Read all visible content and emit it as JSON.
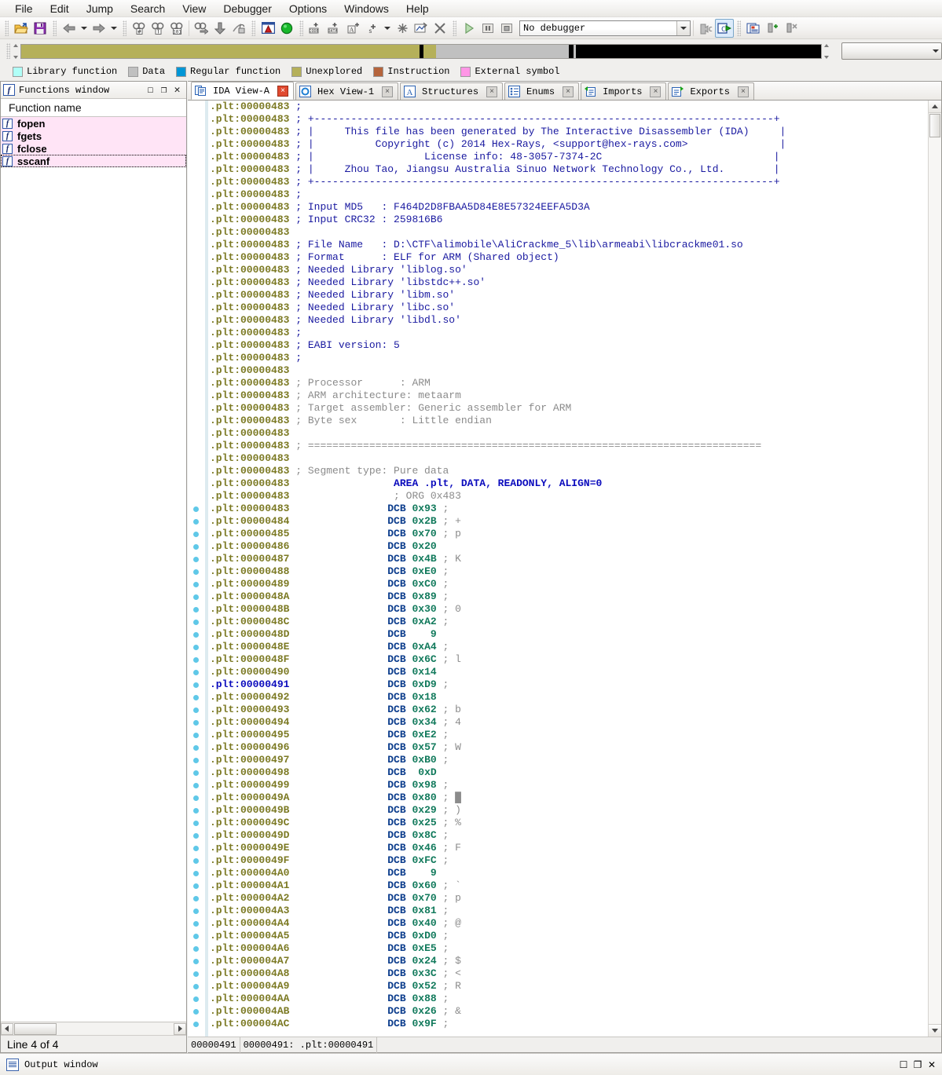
{
  "menu": {
    "items": [
      "File",
      "Edit",
      "Jump",
      "Search",
      "View",
      "Debugger",
      "Options",
      "Windows",
      "Help"
    ]
  },
  "toolbar": {
    "debugger_value": "No debugger",
    "icons": [
      "open-file-icon",
      "save-icon",
      "back-arrow-icon",
      "back-dropdown-icon",
      "forward-arrow-icon",
      "forward-dropdown-icon",
      "search-hash-icon",
      "search-text-icon",
      "search-binary-icon",
      "search-next-icon",
      "jump-down-icon",
      "unlock-icon",
      "warning-icon",
      "green-circle-icon",
      "make-code-icon",
      "make-data-icon",
      "make-ascii-icon",
      "make-struct-icon",
      "make-struct-dropdown-icon",
      "make-unexplored-icon",
      "edit-function-icon",
      "delete-icon",
      "run-icon",
      "pause-icon",
      "stop-icon"
    ],
    "right_icons": [
      "decompile-gray-icon",
      "decompile-icon",
      "struct-view-icon",
      "add-breakpoint-icon",
      "delete-breakpoint-icon"
    ]
  },
  "navbar": {
    "combo_value": "",
    "segments": [
      {
        "name": "unexplored-left",
        "color": "#b5b05a",
        "left_pct": 0.0,
        "width_pct": 49.8
      },
      {
        "name": "cursor-marker",
        "color": "#000000",
        "left_pct": 49.8,
        "width_pct": 0.5
      },
      {
        "name": "unexplored-right",
        "color": "#b5b05a",
        "left_pct": 50.3,
        "width_pct": 1.6
      },
      {
        "name": "data-gray",
        "color": "#c0c0c0",
        "left_pct": 51.9,
        "width_pct": 16.6
      },
      {
        "name": "divider-marker",
        "color": "#000000",
        "left_pct": 68.5,
        "width_pct": 0.6
      },
      {
        "name": "black-region",
        "color": "#000000",
        "left_pct": 69.4,
        "width_pct": 30.6
      }
    ]
  },
  "legend": {
    "items": [
      {
        "label": "Library function",
        "color": "#b0fff7"
      },
      {
        "label": "Data",
        "color": "#c0c0c0"
      },
      {
        "label": "Regular function",
        "color": "#0096d6"
      },
      {
        "label": "Unexplored",
        "color": "#b5b05a"
      },
      {
        "label": "Instruction",
        "color": "#b5643c"
      },
      {
        "label": "External symbol",
        "color": "#ff96e6"
      }
    ]
  },
  "functions_window": {
    "title": "Functions window",
    "column_header": "Function name",
    "rows": [
      "fopen",
      "fgets",
      "fclose",
      "sscanf"
    ],
    "selected_index": 3,
    "status": "Line 4 of 4",
    "window_buttons": [
      "maximize",
      "restore",
      "close"
    ]
  },
  "tabs": [
    {
      "label": "IDA View-A",
      "icon": "ida-view-icon",
      "active": true,
      "close_red": true
    },
    {
      "label": "Hex View-1",
      "icon": "hex-view-icon",
      "active": false,
      "close_red": false
    },
    {
      "label": "Structures",
      "icon": "structures-icon",
      "active": false,
      "close_red": false
    },
    {
      "label": "Enums",
      "icon": "enums-icon",
      "active": false,
      "close_red": false
    },
    {
      "label": "Imports",
      "icon": "imports-icon",
      "active": false,
      "close_red": false
    },
    {
      "label": "Exports",
      "icon": "exports-icon",
      "active": false,
      "close_red": false
    }
  ],
  "disassembly": {
    "current_address": "00000491",
    "lines": [
      {
        "addr": ".plt:00000483",
        "text": "; ",
        "style": "cmt"
      },
      {
        "addr": ".plt:00000483",
        "text": "; +---------------------------------------------------------------------------+",
        "style": "cmt"
      },
      {
        "addr": ".plt:00000483",
        "text": "; |     This file has been generated by The Interactive Disassembler (IDA)     |",
        "style": "cmt"
      },
      {
        "addr": ".plt:00000483",
        "text": "; |          Copyright (c) 2014 Hex-Rays, <support@hex-rays.com>               |",
        "style": "cmt"
      },
      {
        "addr": ".plt:00000483",
        "text": "; |                  License info: 48-3057-7374-2C                            |",
        "style": "cmt"
      },
      {
        "addr": ".plt:00000483",
        "text": "; |     Zhou Tao, Jiangsu Australia Sinuo Network Technology Co., Ltd.        |",
        "style": "cmt"
      },
      {
        "addr": ".plt:00000483",
        "text": "; +---------------------------------------------------------------------------+",
        "style": "cmt"
      },
      {
        "addr": ".plt:00000483",
        "text": "; ",
        "style": "cmt"
      },
      {
        "addr": ".plt:00000483",
        "text": "; Input MD5   : F464D2D8FBAA5D84E8E57324EEFA5D3A",
        "style": "cmt"
      },
      {
        "addr": ".plt:00000483",
        "text": "; Input CRC32 : 259816B6",
        "style": "cmt"
      },
      {
        "addr": ".plt:00000483",
        "text": "",
        "style": "cmt"
      },
      {
        "addr": ".plt:00000483",
        "text": "; File Name   : D:\\CTF\\alimobile\\AliCrackme_5\\lib\\armeabi\\libcrackme01.so",
        "style": "cmt"
      },
      {
        "addr": ".plt:00000483",
        "text": "; Format      : ELF for ARM (Shared object)",
        "style": "cmt"
      },
      {
        "addr": ".plt:00000483",
        "text": "; Needed Library 'liblog.so'",
        "style": "cmt"
      },
      {
        "addr": ".plt:00000483",
        "text": "; Needed Library 'libstdc++.so'",
        "style": "cmt"
      },
      {
        "addr": ".plt:00000483",
        "text": "; Needed Library 'libm.so'",
        "style": "cmt"
      },
      {
        "addr": ".plt:00000483",
        "text": "; Needed Library 'libc.so'",
        "style": "cmt"
      },
      {
        "addr": ".plt:00000483",
        "text": "; Needed Library 'libdl.so'",
        "style": "cmt"
      },
      {
        "addr": ".plt:00000483",
        "text": "; ",
        "style": "cmt"
      },
      {
        "addr": ".plt:00000483",
        "text": "; EABI version: 5",
        "style": "cmt"
      },
      {
        "addr": ".plt:00000483",
        "text": "; ",
        "style": "cmt"
      },
      {
        "addr": ".plt:00000483",
        "text": "",
        "style": "cmt"
      },
      {
        "addr": ".plt:00000483",
        "text": "; Processor      : ARM",
        "style": "cmtgray"
      },
      {
        "addr": ".plt:00000483",
        "text": "; ARM architecture: metaarm",
        "style": "cmtgray"
      },
      {
        "addr": ".plt:00000483",
        "text": "; Target assembler: Generic assembler for ARM",
        "style": "cmtgray"
      },
      {
        "addr": ".plt:00000483",
        "text": "; Byte sex       : Little endian",
        "style": "cmtgray"
      },
      {
        "addr": ".plt:00000483",
        "text": "",
        "style": "cmtgray"
      },
      {
        "addr": ".plt:00000483",
        "text": "; ==========================================================================",
        "style": "cmtgray"
      },
      {
        "addr": ".plt:00000483",
        "text": "",
        "style": "cmtgray"
      },
      {
        "addr": ".plt:00000483",
        "text": "; Segment type: Pure data",
        "style": "cmtgray"
      },
      {
        "addr": ".plt:00000483",
        "text": "                AREA .plt, DATA, READONLY, ALIGN=0",
        "style": "kw"
      },
      {
        "addr": ".plt:00000483",
        "text": "                ; ORG 0x483",
        "style": "cmtgray"
      }
    ],
    "dcb_lines": [
      {
        "addr": ".plt:00000483",
        "mnem": "DCB",
        "value": "0x93",
        "comment": ";",
        "ascii": ""
      },
      {
        "addr": ".plt:00000484",
        "mnem": "DCB",
        "value": "0x2B",
        "comment": ";",
        "ascii": "+"
      },
      {
        "addr": ".plt:00000485",
        "mnem": "DCB",
        "value": "0x70",
        "comment": ";",
        "ascii": "p"
      },
      {
        "addr": ".plt:00000486",
        "mnem": "DCB",
        "value": "0x20",
        "comment": "",
        "ascii": ""
      },
      {
        "addr": ".plt:00000487",
        "mnem": "DCB",
        "value": "0x4B",
        "comment": ";",
        "ascii": "K"
      },
      {
        "addr": ".plt:00000488",
        "mnem": "DCB",
        "value": "0xE0",
        "comment": ";",
        "ascii": ""
      },
      {
        "addr": ".plt:00000489",
        "mnem": "DCB",
        "value": "0xC0",
        "comment": ";",
        "ascii": ""
      },
      {
        "addr": ".plt:0000048A",
        "mnem": "DCB",
        "value": "0x89",
        "comment": ";",
        "ascii": ""
      },
      {
        "addr": ".plt:0000048B",
        "mnem": "DCB",
        "value": "0x30",
        "comment": ";",
        "ascii": "0"
      },
      {
        "addr": ".plt:0000048C",
        "mnem": "DCB",
        "value": "0xA2",
        "comment": ";",
        "ascii": ""
      },
      {
        "addr": ".plt:0000048D",
        "mnem": "DCB",
        "value": "   9",
        "comment": "",
        "ascii": ""
      },
      {
        "addr": ".plt:0000048E",
        "mnem": "DCB",
        "value": "0xA4",
        "comment": ";",
        "ascii": ""
      },
      {
        "addr": ".plt:0000048F",
        "mnem": "DCB",
        "value": "0x6C",
        "comment": ";",
        "ascii": "l"
      },
      {
        "addr": ".plt:00000490",
        "mnem": "DCB",
        "value": "0x14",
        "comment": "",
        "ascii": ""
      },
      {
        "addr": ".plt:00000491",
        "mnem": "DCB",
        "value": "0xD9",
        "comment": ";",
        "ascii": "",
        "current": true
      },
      {
        "addr": ".plt:00000492",
        "mnem": "DCB",
        "value": "0x18",
        "comment": "",
        "ascii": ""
      },
      {
        "addr": ".plt:00000493",
        "mnem": "DCB",
        "value": "0x62",
        "comment": ";",
        "ascii": "b"
      },
      {
        "addr": ".plt:00000494",
        "mnem": "DCB",
        "value": "0x34",
        "comment": ";",
        "ascii": "4"
      },
      {
        "addr": ".plt:00000495",
        "mnem": "DCB",
        "value": "0xE2",
        "comment": ";",
        "ascii": ""
      },
      {
        "addr": ".plt:00000496",
        "mnem": "DCB",
        "value": "0x57",
        "comment": ";",
        "ascii": "W"
      },
      {
        "addr": ".plt:00000497",
        "mnem": "DCB",
        "value": "0xB0",
        "comment": ";",
        "ascii": ""
      },
      {
        "addr": ".plt:00000498",
        "mnem": "DCB",
        "value": " 0xD",
        "comment": "",
        "ascii": ""
      },
      {
        "addr": ".plt:00000499",
        "mnem": "DCB",
        "value": "0x98",
        "comment": ";",
        "ascii": ""
      },
      {
        "addr": ".plt:0000049A",
        "mnem": "DCB",
        "value": "0x80",
        "comment": ";",
        "ascii": "█"
      },
      {
        "addr": ".plt:0000049B",
        "mnem": "DCB",
        "value": "0x29",
        "comment": ";",
        "ascii": ")"
      },
      {
        "addr": ".plt:0000049C",
        "mnem": "DCB",
        "value": "0x25",
        "comment": ";",
        "ascii": "%"
      },
      {
        "addr": ".plt:0000049D",
        "mnem": "DCB",
        "value": "0x8C",
        "comment": ";",
        "ascii": ""
      },
      {
        "addr": ".plt:0000049E",
        "mnem": "DCB",
        "value": "0x46",
        "comment": ";",
        "ascii": "F"
      },
      {
        "addr": ".plt:0000049F",
        "mnem": "DCB",
        "value": "0xFC",
        "comment": ";",
        "ascii": ""
      },
      {
        "addr": ".plt:000004A0",
        "mnem": "DCB",
        "value": "   9",
        "comment": "",
        "ascii": ""
      },
      {
        "addr": ".plt:000004A1",
        "mnem": "DCB",
        "value": "0x60",
        "comment": ";",
        "ascii": "`"
      },
      {
        "addr": ".plt:000004A2",
        "mnem": "DCB",
        "value": "0x70",
        "comment": ";",
        "ascii": "p"
      },
      {
        "addr": ".plt:000004A3",
        "mnem": "DCB",
        "value": "0x81",
        "comment": ";",
        "ascii": ""
      },
      {
        "addr": ".plt:000004A4",
        "mnem": "DCB",
        "value": "0x40",
        "comment": ";",
        "ascii": "@"
      },
      {
        "addr": ".plt:000004A5",
        "mnem": "DCB",
        "value": "0xD0",
        "comment": ";",
        "ascii": ""
      },
      {
        "addr": ".plt:000004A6",
        "mnem": "DCB",
        "value": "0xE5",
        "comment": ";",
        "ascii": ""
      },
      {
        "addr": ".plt:000004A7",
        "mnem": "DCB",
        "value": "0x24",
        "comment": ";",
        "ascii": "$"
      },
      {
        "addr": ".plt:000004A8",
        "mnem": "DCB",
        "value": "0x3C",
        "comment": ";",
        "ascii": "<"
      },
      {
        "addr": ".plt:000004A9",
        "mnem": "DCB",
        "value": "0x52",
        "comment": ";",
        "ascii": "R"
      },
      {
        "addr": ".plt:000004AA",
        "mnem": "DCB",
        "value": "0x88",
        "comment": ";",
        "ascii": ""
      },
      {
        "addr": ".plt:000004AB",
        "mnem": "DCB",
        "value": "0x26",
        "comment": ";",
        "ascii": "&"
      },
      {
        "addr": ".plt:000004AC",
        "mnem": "DCB",
        "value": "0x9F",
        "comment": ";",
        "ascii": ""
      }
    ],
    "status_cells": [
      "00000491",
      "00000491: .plt:00000491",
      ""
    ]
  },
  "output_window": {
    "label": "Output window",
    "buttons": [
      "maximize",
      "restore",
      "close"
    ]
  },
  "colors": {
    "address": "#7c7a24",
    "comment_blue": "#1919a0",
    "comment_gray": "#8b8b8b",
    "dcb_value": "#127a5c",
    "keyword_blue": "#0b0bbd",
    "selection_pink": "#ffe4f6",
    "breakpoint_dot": "#5fc8e8",
    "unexplored": "#b5b05a"
  }
}
